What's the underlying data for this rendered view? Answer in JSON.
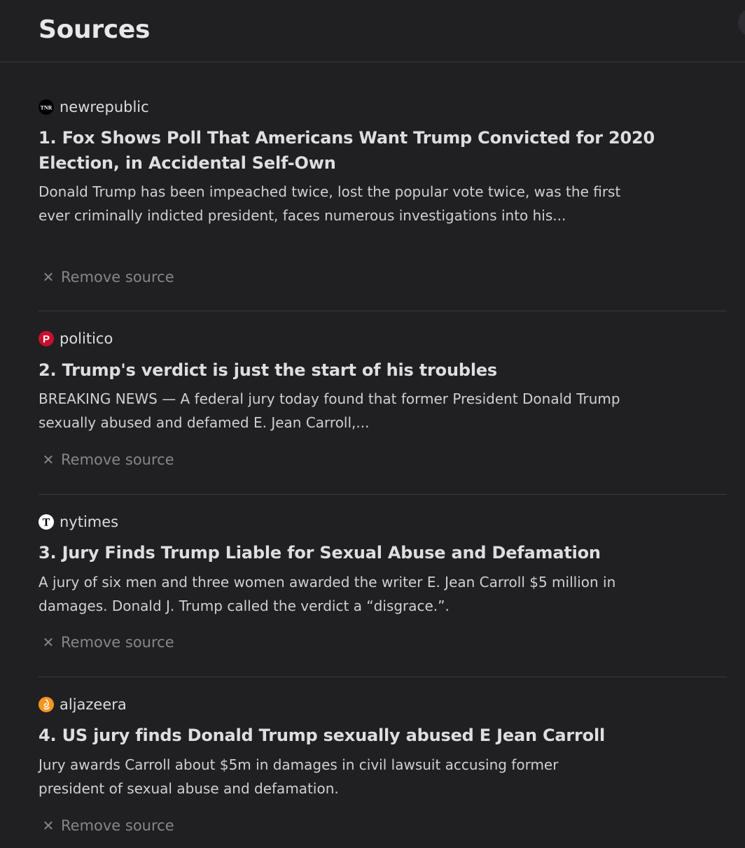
{
  "header": {
    "title": "Sources"
  },
  "sources": [
    {
      "site": "newrepublic",
      "favicon": "tnr-logo-icon",
      "favicon_text": "TNR",
      "favicon_bg": "#000000",
      "title": "1. Fox Shows Poll That Americans Want Trump Convicted for 2020 Election, in Accidental Self-Own",
      "description": "Donald Trump has been impeached twice, lost the popular vote twice, was the first ever criminally indicted president, faces numerous investigations into his...",
      "remove_icon": "close-icon",
      "remove_label": "Remove source"
    },
    {
      "site": "politico",
      "favicon": "politico-logo-icon",
      "favicon_text": "P",
      "favicon_bg": "#c8102e",
      "title": "2. Trump's verdict is just the start of his troubles",
      "description": "BREAKING NEWS — A federal jury today found that former President Donald Trump sexually abused and defamed E. Jean Carroll,...",
      "remove_icon": "close-icon",
      "remove_label": "Remove source"
    },
    {
      "site": "nytimes",
      "favicon": "nytimes-logo-icon",
      "favicon_text": "T",
      "favicon_bg": "#ffffff",
      "title": "3. Jury Finds Trump Liable for Sexual Abuse and Defamation",
      "description": "A jury of six men and three women awarded the writer E. Jean Carroll $5 million in damages. Donald J. Trump called the verdict a “disgrace.”.",
      "remove_icon": "close-icon",
      "remove_label": "Remove source"
    },
    {
      "site": "aljazeera",
      "favicon": "aljazeera-logo-icon",
      "favicon_text": "",
      "favicon_bg": "#f7941d",
      "title": "4. US jury finds Donald Trump sexually abused E Jean Carroll",
      "description": "Jury awards Carroll about $5m in damages in civil lawsuit accusing former president of sexual abuse and defamation.",
      "remove_icon": "close-icon",
      "remove_label": "Remove source"
    }
  ]
}
